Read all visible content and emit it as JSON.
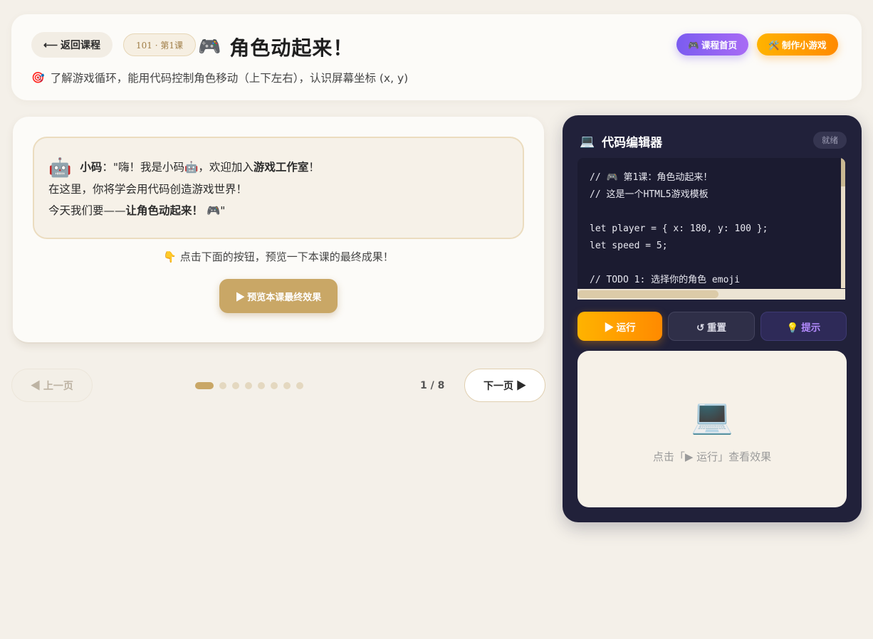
{
  "header": {
    "back_label": "⟵ 返回课程",
    "lesson_badge": "101 · 第1课",
    "title_icon": "🎮",
    "title": "角色动起来！",
    "subtitle_icon": "🎯",
    "subtitle": "了解游戏循环，能用代码控制角色移动（上下左右），认识屏幕坐标 (x, y)",
    "home_btn": "🎮 课程首页",
    "make_btn": "🛠️ 制作小游戏"
  },
  "lesson": {
    "robot_icon": "🤖",
    "speaker": "小码",
    "line1_a": "：\"嗨！我是小码🤖，欢迎加入",
    "line1_b": "游戏工作室",
    "line1_c": "！",
    "line2": "在这里，你将学会用代码创造游戏世界！",
    "line3_a": "今天我们要——",
    "line3_b": "让角色动起来！",
    "line3_c": " 🎮\"",
    "hint": "👇 点击下面的按钮，预览一下本课的最终成果！",
    "preview_btn": "▶ 预览本课最终效果"
  },
  "pagination": {
    "prev_label": "◀ 上一页",
    "next_label": "下一页 ▶",
    "page_text": "1 / 8",
    "total_pages": 8,
    "current_page": 1
  },
  "editor": {
    "icon": "💻",
    "title": "代码编辑器",
    "status": "就绪",
    "code_lines": [
      "// 🎮 第1课：角色动起来！",
      "// 这是一个HTML5游戏模板",
      "",
      "let player = { x: 180, y: 100 };",
      "let speed = 5;",
      "",
      "// TODO 1: 选择你的角色 emoji"
    ],
    "run_btn": "▶ 运行",
    "reset_btn": "↺ 重置",
    "hint_btn": "💡 提示",
    "output_icon": "💻",
    "output_text": "点击「▶ 运行」查看效果"
  },
  "colors": {
    "accent_gold": "#c9a766",
    "accent_purple": "#7b5cf0",
    "accent_orange": "#ff8a00",
    "editor_bg": "#21213a"
  }
}
